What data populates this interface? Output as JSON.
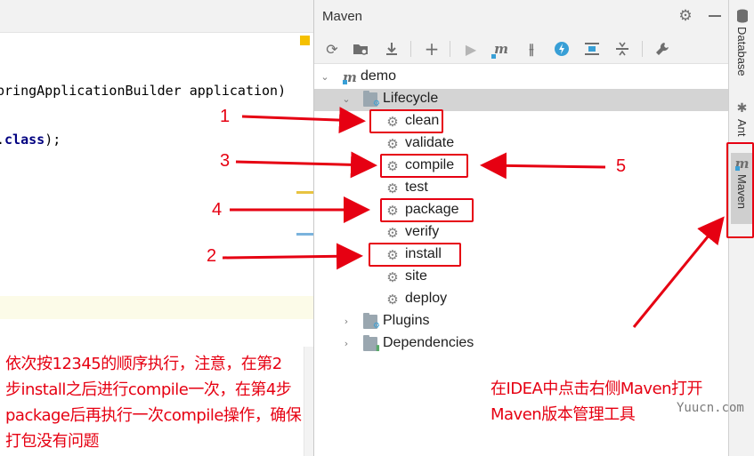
{
  "editor": {
    "code_line_1": "pringApplicationBuilder application)",
    "code_line_2_prefix": ".",
    "code_line_2_keyword": "class",
    "code_line_2_suffix": ");"
  },
  "maven": {
    "title": "Maven",
    "tree": {
      "root": "demo",
      "lifecycle": "Lifecycle",
      "phases": [
        "clean",
        "validate",
        "compile",
        "test",
        "package",
        "verify",
        "install",
        "site",
        "deploy"
      ],
      "plugins": "Plugins",
      "dependencies": "Dependencies"
    }
  },
  "stripe": {
    "database": "Database",
    "ant": "Ant",
    "maven": "Maven"
  },
  "annotations": {
    "n1": "1",
    "n2": "2",
    "n3": "3",
    "n4": "4",
    "n5": "5",
    "note_left_1": "依次按12345的顺序执行，注意，在第2",
    "note_left_2": "步install之后进行compile一次，在第4步",
    "note_left_3": "package后再执行一次compile操作，确保",
    "note_left_4": "打包没有问题",
    "note_right_1": "在IDEA中点击右侧Maven打开",
    "note_right_2": "Maven版本管理工具",
    "watermark": "Yuucn.com"
  },
  "colors": {
    "annotation_red": "#e60012",
    "selection_gray": "#d4d4d4",
    "maven_blue": "#389fd6"
  }
}
